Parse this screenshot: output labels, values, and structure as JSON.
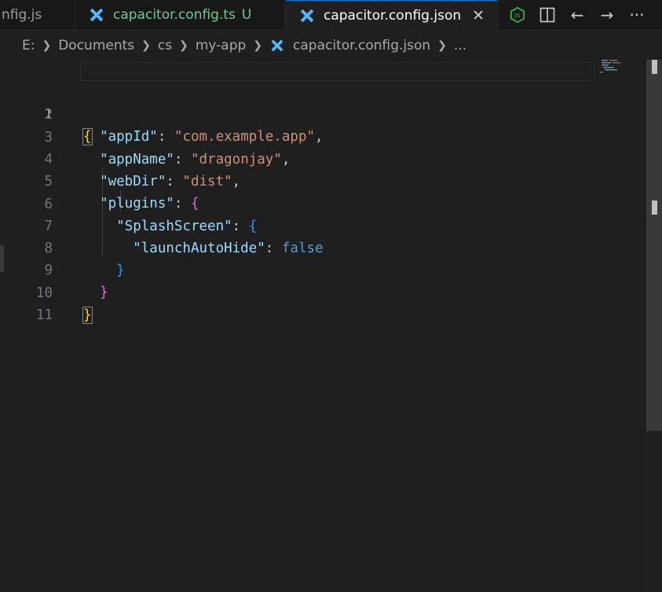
{
  "tabs": [
    {
      "label": "nfig.js"
    },
    {
      "label": "capacitor.config.ts",
      "status": "U"
    },
    {
      "label": "capacitor.config.json",
      "close": "✕"
    }
  ],
  "actions": {
    "split": "◫",
    "back": "←",
    "forward": "→",
    "more": "···"
  },
  "breadcrumb": [
    "E:",
    "Documents",
    "cs",
    "my-app",
    "capacitor.config.json",
    "..."
  ],
  "line_numbers": [
    "1",
    "2",
    "3",
    "4",
    "5",
    "6",
    "7",
    "8",
    "9",
    "10",
    "11"
  ],
  "code": {
    "l1_open": "{",
    "appId_key": "\"appId\"",
    "appId_val": "\"com.example.app\"",
    "appName_key": "\"appName\"",
    "appName_val": "\"dragonjay\"",
    "webDir_key": "\"webDir\"",
    "webDir_val": "\"dist\"",
    "plugins_key": "\"plugins\"",
    "plugins_open": "{",
    "splash_key": "\"SplashScreen\"",
    "splash_open": "{",
    "launch_key": "\"launchAutoHide\"",
    "launch_val": "false",
    "splash_close": "}",
    "plugins_close": "}",
    "root_close": "}"
  },
  "colors": {
    "accent": "#0078d4",
    "key": "#9cdcfe",
    "string": "#ce9178",
    "keyword": "#569cd6",
    "untracked": "#73c991"
  }
}
